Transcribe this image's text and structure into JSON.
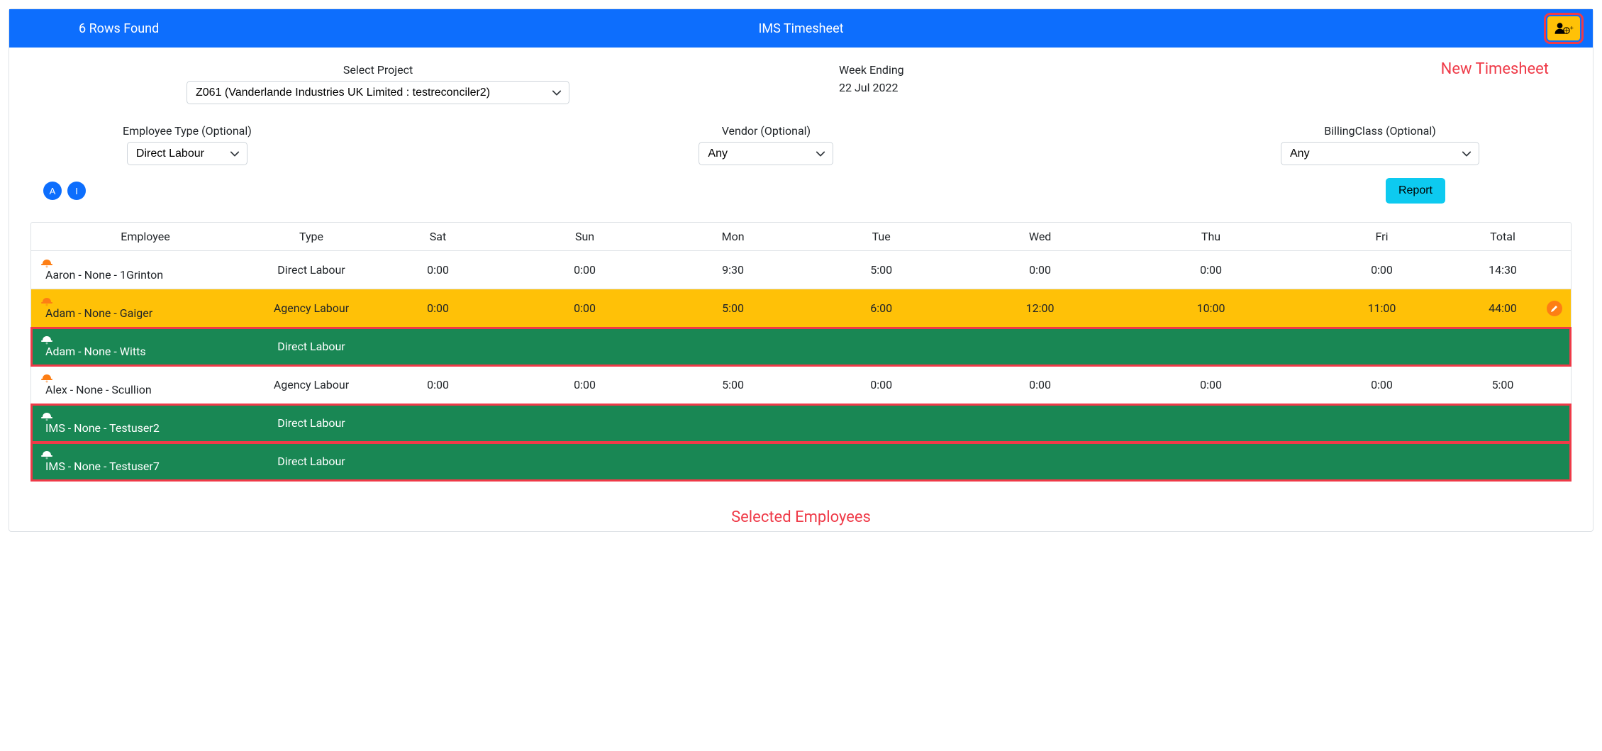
{
  "header": {
    "rows_found": "6 Rows Found",
    "title": "IMS Timesheet"
  },
  "annotations": {
    "new_timesheet": "New Timesheet",
    "selected_employees": "Selected Employees"
  },
  "filters": {
    "project_label": "Select Project",
    "project_value": "Z061 (Vanderlande Industries UK Limited : testreconciler2)",
    "week_label": "Week Ending",
    "week_value": "22 Jul 2022",
    "emptype_label": "Employee Type (Optional)",
    "emptype_value": "Direct Labour",
    "vendor_label": "Vendor (Optional)",
    "vendor_value": "Any",
    "billing_label": "BillingClass (Optional)",
    "billing_value": "Any"
  },
  "letters": [
    "A",
    "I"
  ],
  "report_label": "Report",
  "table": {
    "headers": [
      "Employee",
      "Type",
      "Sat",
      "Sun",
      "Mon",
      "Tue",
      "Wed",
      "Thu",
      "Fri",
      "Total"
    ],
    "rows": [
      {
        "style": "normal",
        "icon": "orange",
        "employee": "Aaron - None - 1Grinton",
        "type": "Direct Labour",
        "sat": "0:00",
        "sun": "0:00",
        "mon": "9:30",
        "tue": "5:00",
        "wed": "0:00",
        "thu": "0:00",
        "fri": "0:00",
        "total": "14:30",
        "editable": false,
        "selected": false
      },
      {
        "style": "amber",
        "icon": "orange",
        "employee": "Adam - None - Gaiger",
        "type": "Agency Labour",
        "sat": "0:00",
        "sun": "0:00",
        "mon": "5:00",
        "tue": "6:00",
        "wed": "12:00",
        "thu": "10:00",
        "fri": "11:00",
        "total": "44:00",
        "editable": true,
        "selected": false
      },
      {
        "style": "green",
        "icon": "white",
        "employee": "Adam - None - Witts",
        "type": "Direct Labour",
        "sat": "",
        "sun": "",
        "mon": "",
        "tue": "",
        "wed": "",
        "thu": "",
        "fri": "",
        "total": "",
        "editable": false,
        "selected": true
      },
      {
        "style": "normal",
        "icon": "orange",
        "employee": "Alex - None - Scullion",
        "type": "Agency Labour",
        "sat": "0:00",
        "sun": "0:00",
        "mon": "5:00",
        "tue": "0:00",
        "wed": "0:00",
        "thu": "0:00",
        "fri": "0:00",
        "total": "5:00",
        "editable": false,
        "selected": false
      },
      {
        "style": "green",
        "icon": "white",
        "employee": "IMS - None - Testuser2",
        "type": "Direct Labour",
        "sat": "",
        "sun": "",
        "mon": "",
        "tue": "",
        "wed": "",
        "thu": "",
        "fri": "",
        "total": "",
        "editable": false,
        "selected": true
      },
      {
        "style": "green",
        "icon": "white",
        "employee": "IMS - None - Testuser7",
        "type": "Direct Labour",
        "sat": "",
        "sun": "",
        "mon": "",
        "tue": "",
        "wed": "",
        "thu": "",
        "fri": "",
        "total": "",
        "editable": false,
        "selected": true
      }
    ]
  }
}
